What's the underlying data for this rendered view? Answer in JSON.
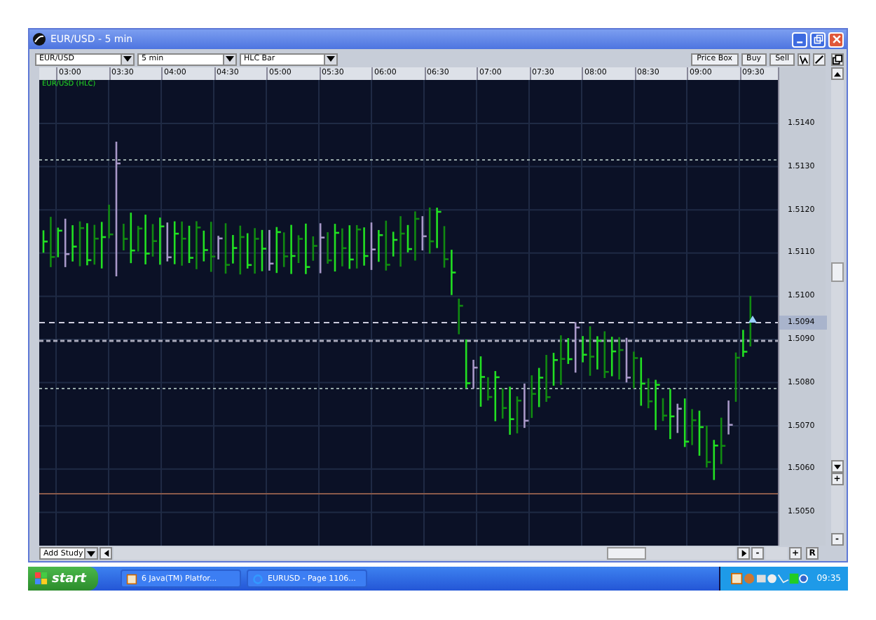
{
  "window": {
    "title": "EUR/USD - 5 min"
  },
  "toolbar": {
    "instrument": "EUR/USD",
    "period": "5 min",
    "chart_type": "HLC Bar",
    "buttons": [
      "Price Box",
      "Buy",
      "Sell"
    ]
  },
  "time_axis": [
    "03:00",
    "03:30",
    "04:00",
    "04:30",
    "05:00",
    "05:30",
    "06:00",
    "06:30",
    "07:00",
    "07:30",
    "08:00",
    "08:30",
    "09:00",
    "09:30"
  ],
  "chart": {
    "label": "EUR/USD (HLC)"
  },
  "price_axis": {
    "ticks": [
      "1.5140",
      "1.5130",
      "1.5120",
      "1.5110",
      "1.5100",
      "1.5090",
      "1.5080",
      "1.5070",
      "1.5060",
      "1.5050"
    ],
    "current": "1.5094"
  },
  "side_zoom": [
    "+",
    "-"
  ],
  "bottom_bar": {
    "study_button": "Add Study",
    "zoom": [
      "-",
      "+"
    ],
    "reset_button": "R"
  },
  "taskbar": {
    "start": "start",
    "tasks": [
      "6 Java(TM) Platfor...",
      "EURUSD - Page 1106..."
    ],
    "clock": "09:35"
  }
}
